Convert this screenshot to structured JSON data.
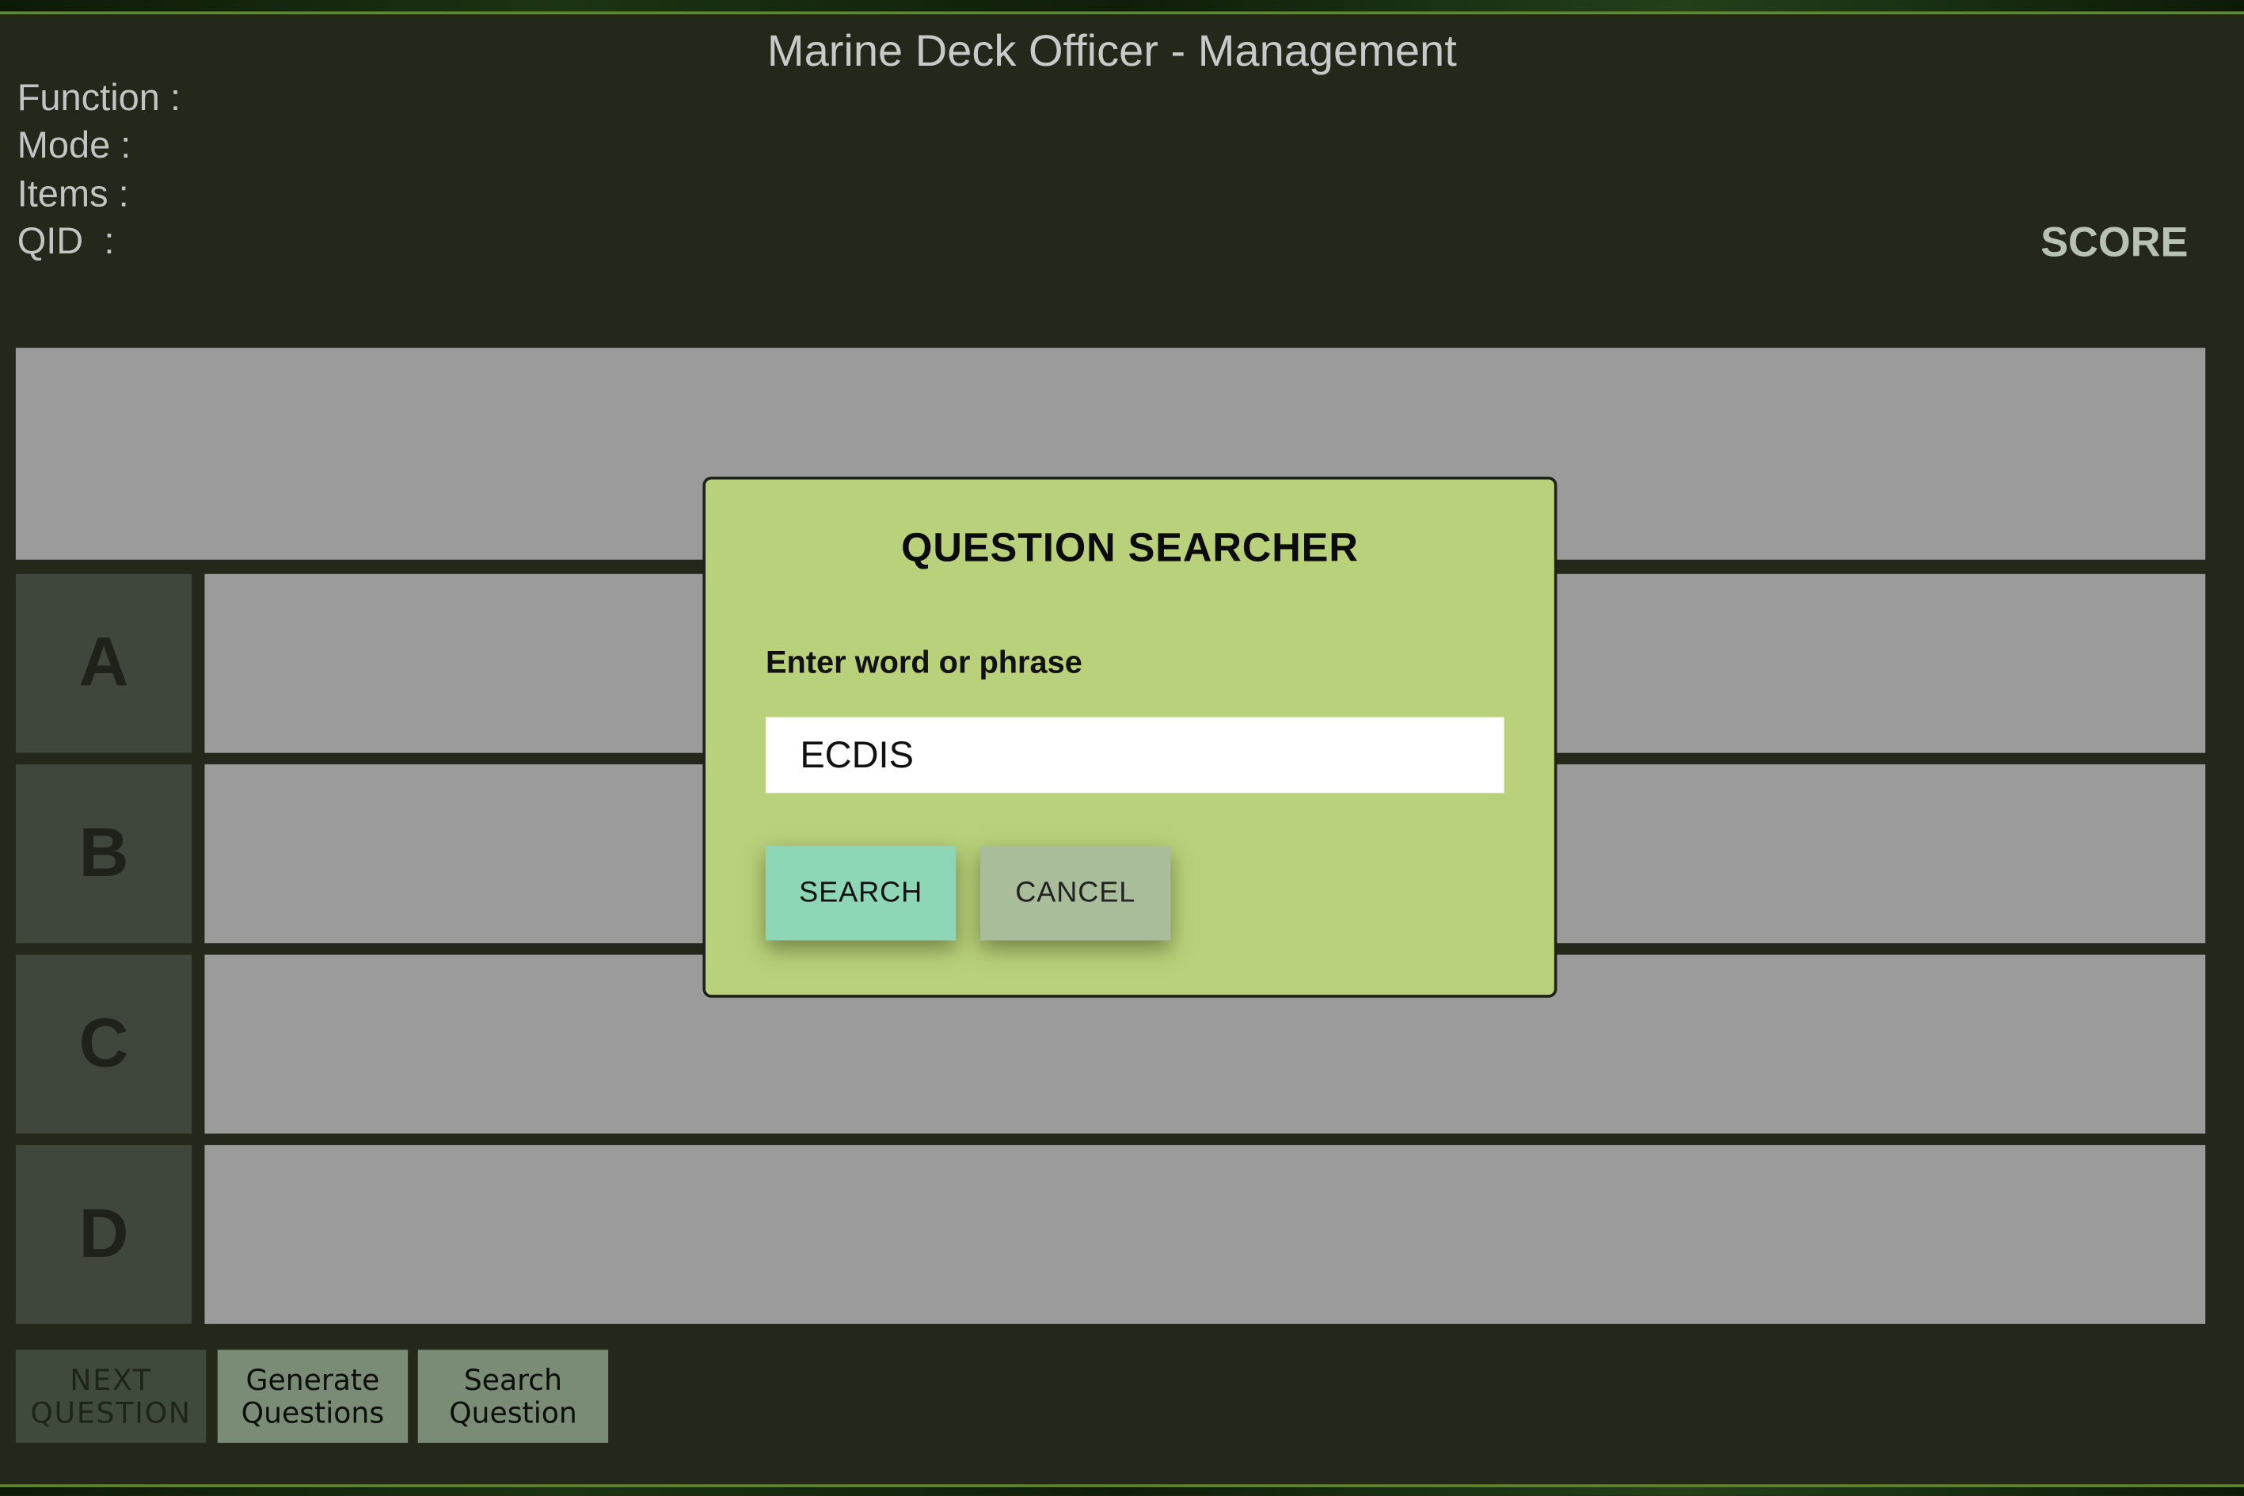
{
  "header": {
    "title": "Marine Deck Officer - Management",
    "info_labels": [
      "Function :",
      "Mode :",
      "Items :",
      "QID  :"
    ],
    "score_label": "SCORE"
  },
  "question": {
    "text": ""
  },
  "answers": [
    {
      "letter": "A",
      "text": ""
    },
    {
      "letter": "B",
      "text": ""
    },
    {
      "letter": "C",
      "text": ""
    },
    {
      "letter": "D",
      "text": ""
    }
  ],
  "buttons": {
    "next": [
      "NEXT",
      "QUESTION"
    ],
    "generate": [
      "Generate",
      "Questions"
    ],
    "search": [
      "Search",
      "Question"
    ]
  },
  "modal": {
    "title": "QUESTION SEARCHER",
    "label": "Enter word or phrase",
    "input_value": "ECDIS",
    "search_label": "SEARCH",
    "cancel_label": "CANCEL"
  },
  "colors": {
    "background": "#23281b",
    "panel": "#9b9b9b",
    "modal": "#b9d17a",
    "search_button": "#8dd6b6",
    "cancel_button": "#a9bd9b"
  }
}
